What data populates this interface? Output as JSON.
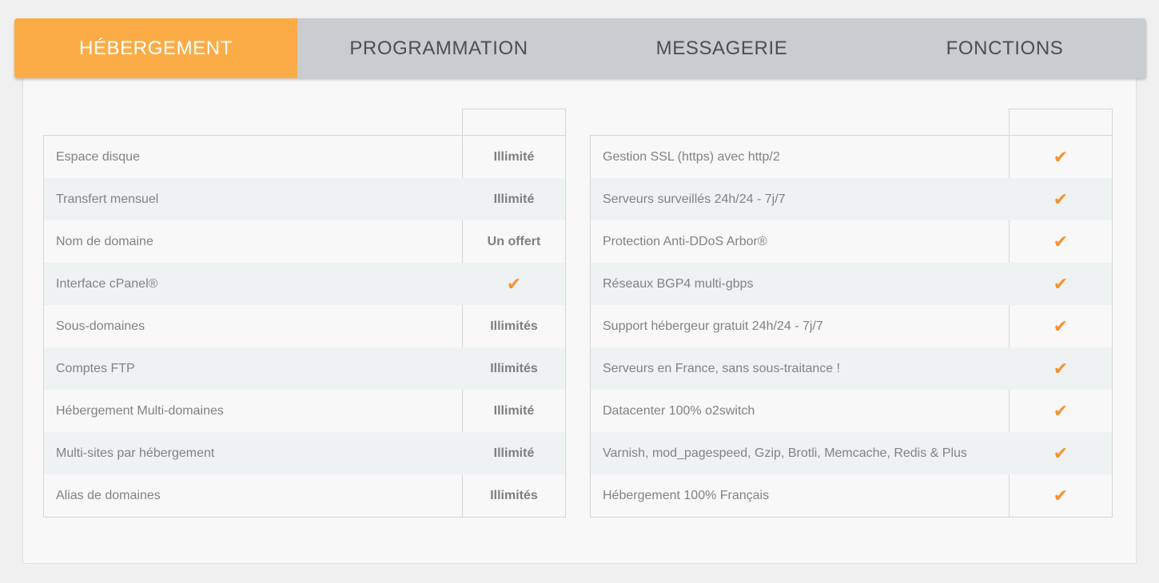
{
  "tabs": [
    {
      "label": "HÉBERGEMENT",
      "active": true
    },
    {
      "label": "PROGRAMMATION",
      "active": false
    },
    {
      "label": "MESSAGERIE",
      "active": false
    },
    {
      "label": "FONCTIONS",
      "active": false
    }
  ],
  "check_glyph": "✔",
  "left_table": {
    "rows": [
      {
        "label": "Espace disque",
        "value": "Illimité"
      },
      {
        "label": "Transfert mensuel",
        "value": "Illimité"
      },
      {
        "label": "Nom de domaine",
        "value": "Un offert"
      },
      {
        "label": "Interface cPanel®",
        "value": "✔"
      },
      {
        "label": "Sous-domaines",
        "value": "Illimités"
      },
      {
        "label": "Comptes FTP",
        "value": "Illimités"
      },
      {
        "label": "Hébergement Multi-domaines",
        "value": "Illimité"
      },
      {
        "label": "Multi-sites par hébergement",
        "value": "Illimité"
      },
      {
        "label": "Alias de domaines",
        "value": "Illimités"
      }
    ]
  },
  "right_table": {
    "rows": [
      {
        "label": "Gestion SSL (https) avec http/2",
        "value": "✔"
      },
      {
        "label": "Serveurs surveillés 24h/24 - 7j/7",
        "value": "✔"
      },
      {
        "label": "Protection Anti-DDoS Arbor®",
        "value": "✔"
      },
      {
        "label": "Réseaux BGP4 multi-gbps",
        "value": "✔"
      },
      {
        "label": "Support hébergeur gratuit 24h/24 - 7j/7",
        "value": "✔"
      },
      {
        "label": "Serveurs en France, sans sous-traitance !",
        "value": "✔"
      },
      {
        "label": "Datacenter 100% o2switch",
        "value": "✔"
      },
      {
        "label": "Varnish, mod_pagespeed, Gzip, Brotli, Memcache, Redis & Plus",
        "value": "✔"
      },
      {
        "label": "Hébergement 100% Français",
        "value": "✔"
      }
    ]
  },
  "colors": {
    "active_tab": "#fbac47",
    "inactive_tabs": "#c9cdcf",
    "check": "#f5922f"
  }
}
